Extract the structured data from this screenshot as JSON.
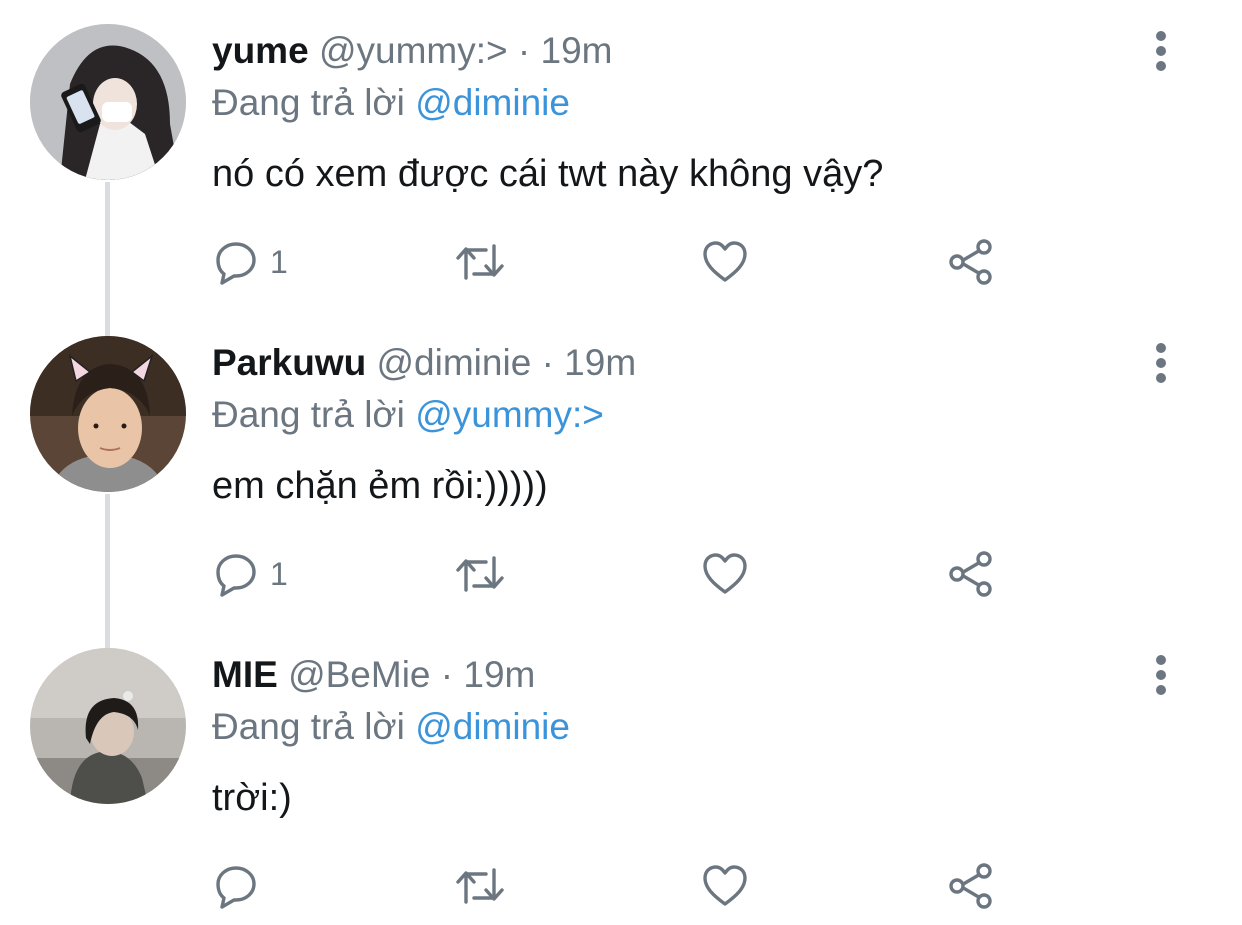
{
  "tweets": [
    {
      "display_name": "yume",
      "handle": "@yummy:>",
      "separator": "·",
      "time": "19m",
      "reply_prefix": "Đang trả lời",
      "reply_to": "@diminie",
      "text": "nó có xem được cái twt này không vậy?",
      "reply_count": "1"
    },
    {
      "display_name": "Parkuwu",
      "handle": "@diminie",
      "separator": "·",
      "time": "19m",
      "reply_prefix": "Đang trả lời",
      "reply_to": "@yummy:>",
      "text": "em chặn ẻm rồi:)))))",
      "reply_count": "1"
    },
    {
      "display_name": "MIE",
      "handle": "@BeMie",
      "separator": "·",
      "time": "19m",
      "reply_prefix": "Đang trả lời",
      "reply_to": "@diminie",
      "text": "trời:)",
      "reply_count": ""
    }
  ],
  "colors": {
    "text_primary": "#14171a",
    "text_secondary": "#6b7680",
    "mention_blue": "#3b94d9",
    "thread_line": "#d9dde1"
  },
  "icons": {
    "reply": "reply-icon",
    "retweet": "retweet-icon",
    "like": "like-icon",
    "share": "share-icon",
    "more": "more-vertical-icon"
  }
}
